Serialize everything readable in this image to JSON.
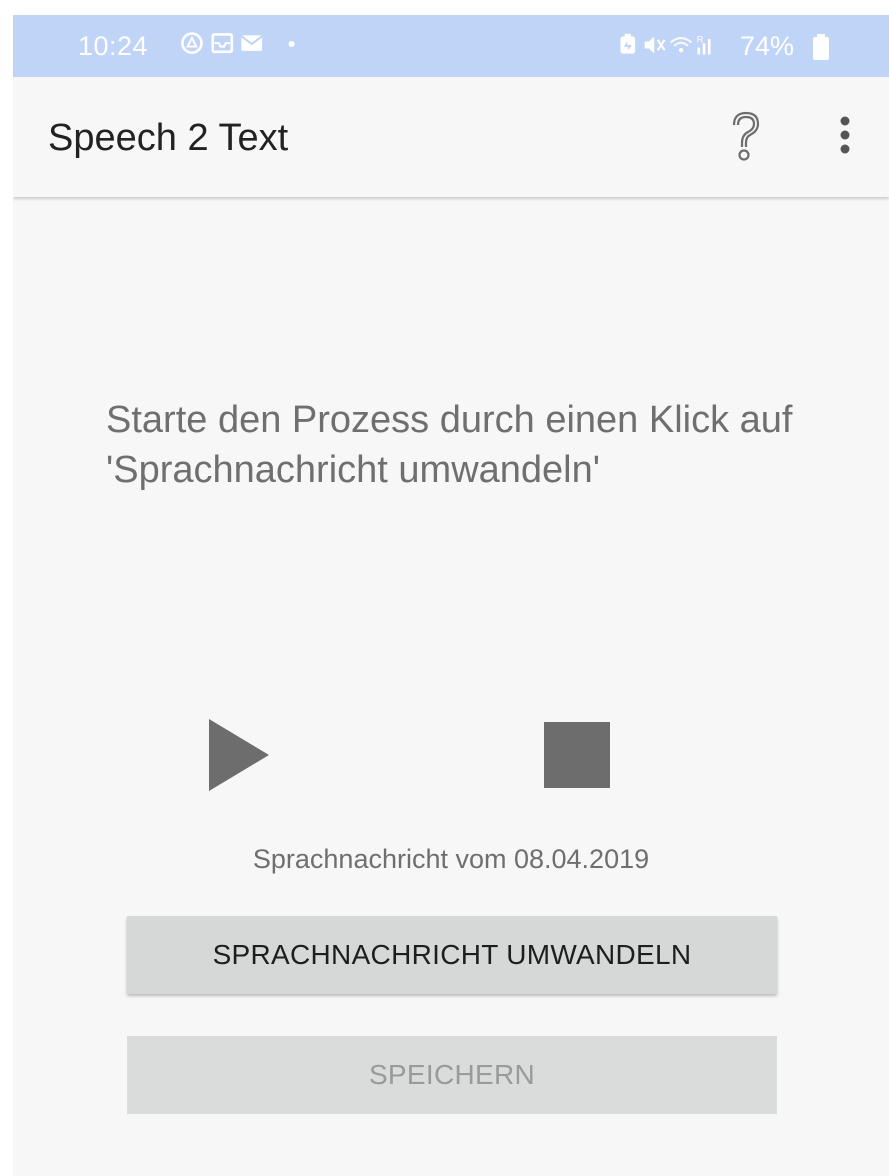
{
  "status_bar": {
    "time": "10:24",
    "battery": "74%",
    "left_icons": [
      "drive-icon",
      "inbox-icon",
      "mail-icon",
      "dot-icon"
    ],
    "right_icons": [
      "battery-saver-icon",
      "mute-icon",
      "wifi-icon",
      "signal-icon",
      "battery-icon"
    ]
  },
  "app_bar": {
    "title": "Speech 2 Text",
    "help_icon": "help-question-icon",
    "menu_icon": "more-vert-icon"
  },
  "main": {
    "instruction": "Starte den Prozess durch einen Klick auf 'Sprachnachricht umwandeln'",
    "play_icon": "play-icon",
    "stop_icon": "stop-icon",
    "message_date": "Sprachnachricht vom 08.04.2019",
    "convert_label": "SPRACHNACHRICHT UMWANDELN",
    "save_label": "SPEICHERN"
  },
  "colors": {
    "status_bar": "#c0d4f8",
    "background": "#f7f7f7",
    "button": "#d6d8d8",
    "icon_gray": "#6d6d6d"
  }
}
